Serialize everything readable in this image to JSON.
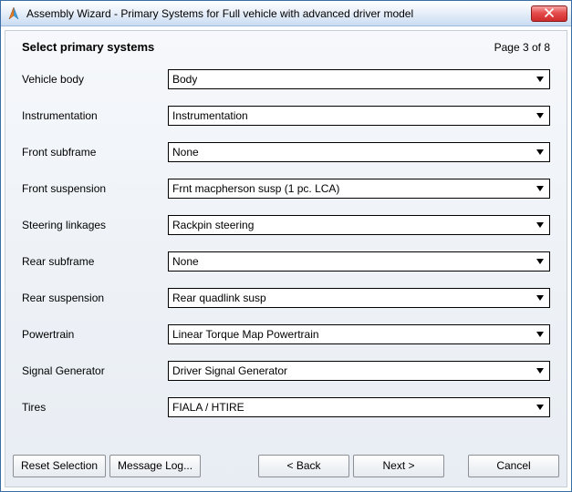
{
  "window": {
    "title": "Assembly Wizard - Primary Systems for Full vehicle with advanced driver model"
  },
  "page": {
    "heading": "Select primary systems",
    "page_indicator": "Page  3 of 8"
  },
  "fields": [
    {
      "label": "Vehicle body",
      "value": "Body"
    },
    {
      "label": "Instrumentation",
      "value": "Instrumentation"
    },
    {
      "label": "Front subframe",
      "value": "None"
    },
    {
      "label": "Front suspension",
      "value": "Frnt macpherson susp (1 pc. LCA)"
    },
    {
      "label": "Steering linkages",
      "value": "Rackpin steering"
    },
    {
      "label": "Rear subframe",
      "value": "None"
    },
    {
      "label": "Rear suspension",
      "value": "Rear quadlink susp"
    },
    {
      "label": "Powertrain",
      "value": "Linear Torque Map Powertrain"
    },
    {
      "label": "Signal Generator",
      "value": "Driver Signal Generator"
    },
    {
      "label": "Tires",
      "value": "FIALA / HTIRE"
    }
  ],
  "buttons": {
    "reset": "Reset Selection",
    "msglog": "Message Log...",
    "back": "< Back",
    "next": "Next >",
    "cancel": "Cancel"
  }
}
